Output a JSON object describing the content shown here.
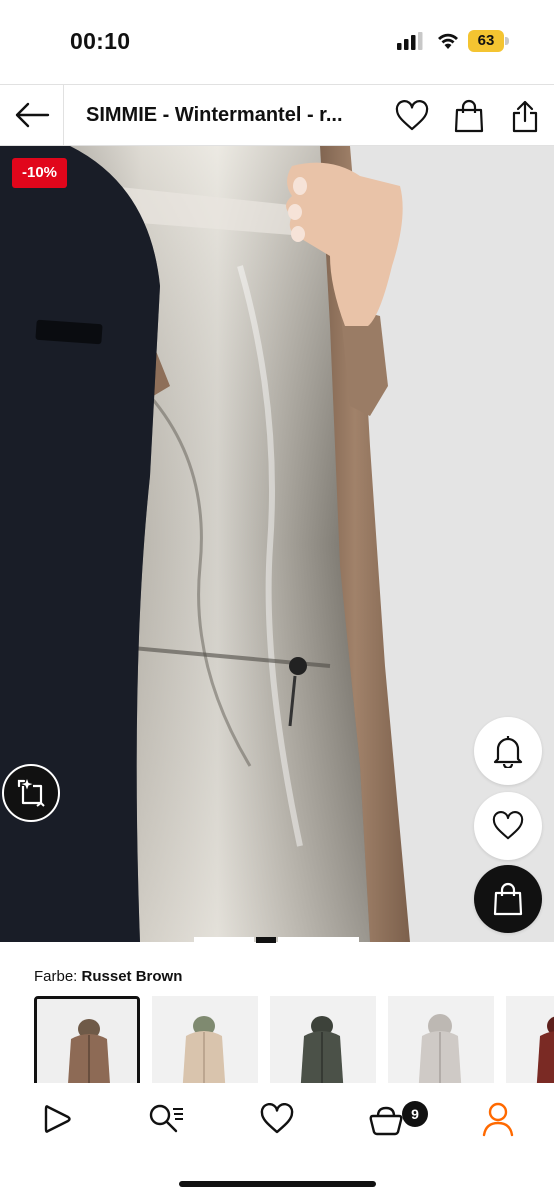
{
  "status_bar": {
    "time": "00:10",
    "battery": "63",
    "battery_color": "#f4c431"
  },
  "header": {
    "title": "SIMMIE - Wintermantel - r...",
    "back_icon": "arrow-left-icon",
    "icons": [
      "heart-icon",
      "shopping-bag-icon",
      "share-icon"
    ]
  },
  "product": {
    "discount_badge": "-10%",
    "badge_color": "#e1061b",
    "image_count": 2,
    "active_image_index": 1,
    "floating_actions": [
      "bell-icon",
      "heart-icon",
      "shopping-bag-icon"
    ],
    "crop_icon": "crop-icon"
  },
  "color_selector": {
    "label": "Farbe:",
    "value": "Russet Brown",
    "swatches": [
      {
        "name": "Russet Brown",
        "color": "#8d6a55",
        "selected": true
      },
      {
        "name": "Beige",
        "color": "#d9c4ad",
        "selected": false
      },
      {
        "name": "Dark Green",
        "color": "#4b5148",
        "selected": false
      },
      {
        "name": "Light Grey",
        "color": "#cfcac6",
        "selected": false
      },
      {
        "name": "Red Brown",
        "color": "#7a2a24",
        "selected": false
      }
    ]
  },
  "bottom_nav": {
    "items": [
      "play-icon",
      "search-list-icon",
      "heart-icon",
      "shopping-bag-icon",
      "user-icon"
    ],
    "cart_count": "9",
    "active_color": "#ff6900"
  }
}
